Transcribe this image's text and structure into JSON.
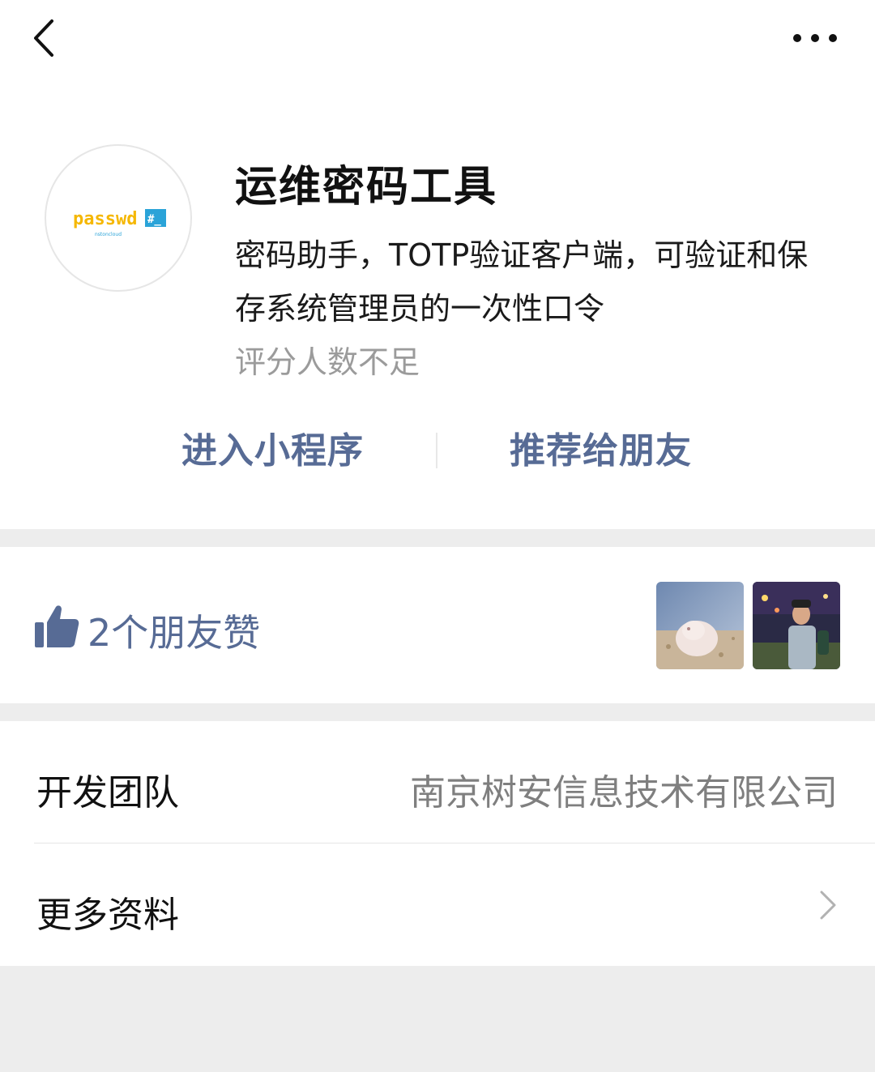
{
  "app": {
    "name": "运维密码工具",
    "description": "密码助手，TOTP验证客户端，可验证和保存系统管理员的一次性口令",
    "rating_text": "评分人数不足",
    "logo_text": "passwd",
    "logo_tag": "#_",
    "logo_subtext": "nstoncloud"
  },
  "actions": {
    "enter_label": "进入小程序",
    "recommend_label": "推荐给朋友"
  },
  "likes": {
    "text": "2个朋友赞",
    "friends": [
      "friend-hamster",
      "friend-selfie"
    ]
  },
  "info": {
    "developer_label": "开发团队",
    "developer_value": "南京树安信息技术有限公司",
    "more_label": "更多资料"
  },
  "colors": {
    "link": "#576b95",
    "logo_yellow": "#f5b700",
    "logo_cyan": "#2aa3d8",
    "background": "#ededed"
  }
}
